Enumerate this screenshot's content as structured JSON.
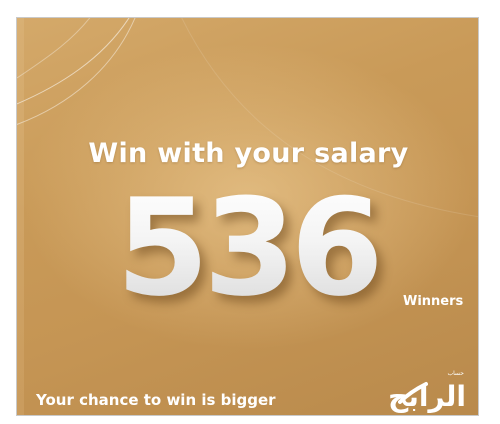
{
  "banner": {
    "headline": "Win with your salary",
    "number": "536",
    "number_label": "Winners",
    "tagline": "Your chance to win is bigger"
  },
  "logo": {
    "text": "الرابح",
    "caption": "حساب"
  },
  "colors": {
    "background": "#c99a58",
    "text": "#ffffff",
    "number": "#f2f2f2"
  }
}
